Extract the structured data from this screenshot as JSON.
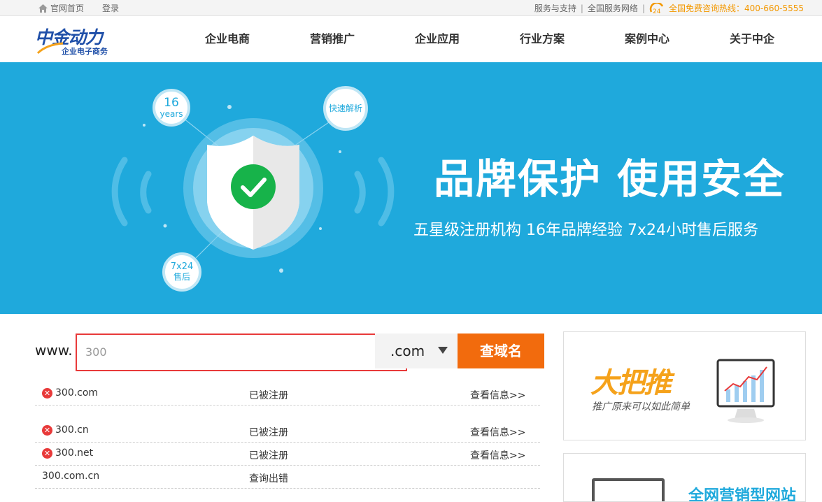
{
  "topbar": {
    "home_label": "官网首页",
    "login_label": "登录",
    "support_label": "服务与支持",
    "network_label": "全国服务网络",
    "hotline_label": "全国免费咨询热线：400-660-5555",
    "icon_24_text": "24"
  },
  "header": {
    "logo_brand": "中金动力",
    "logo_sub": "企业电子商务",
    "nav": [
      "企业电商",
      "营销推广",
      "企业应用",
      "行业方案",
      "案例中心",
      "关于中企"
    ]
  },
  "banner": {
    "headline": "品牌保护  使用安全",
    "subline": "五星级注册机构  16年品牌经验  7x24小时售后服务",
    "badge_years_num": "16",
    "badge_years_unit": "years",
    "badge_fast": "快速解析",
    "badge_service_num": "7x24",
    "badge_service_unit": "售后"
  },
  "search": {
    "prefix": "www.",
    "value": "300",
    "tld": ".com",
    "button_label": "查域名"
  },
  "results": [
    {
      "domain": "300.com",
      "status": "已被注册",
      "link": "查看信息>>",
      "taken": true
    },
    {
      "domain": "300.cn",
      "status": "已被注册",
      "link": "查看信息>>",
      "taken": true
    },
    {
      "domain": "300.net",
      "status": "已被注册",
      "link": "查看信息>>",
      "taken": true
    },
    {
      "domain": "300.com.cn",
      "status": "查询出错",
      "link": "",
      "taken": false
    }
  ],
  "ads": {
    "ad1_title": "大把推",
    "ad1_sub": "推广原来可以如此简单",
    "ad2_title": "全网营销型网站"
  },
  "colors": {
    "banner_bg": "#1fa9dc",
    "accent_orange": "#f26b0d",
    "error_red": "#e83a3a",
    "brand_blue": "#1f4fa8"
  }
}
